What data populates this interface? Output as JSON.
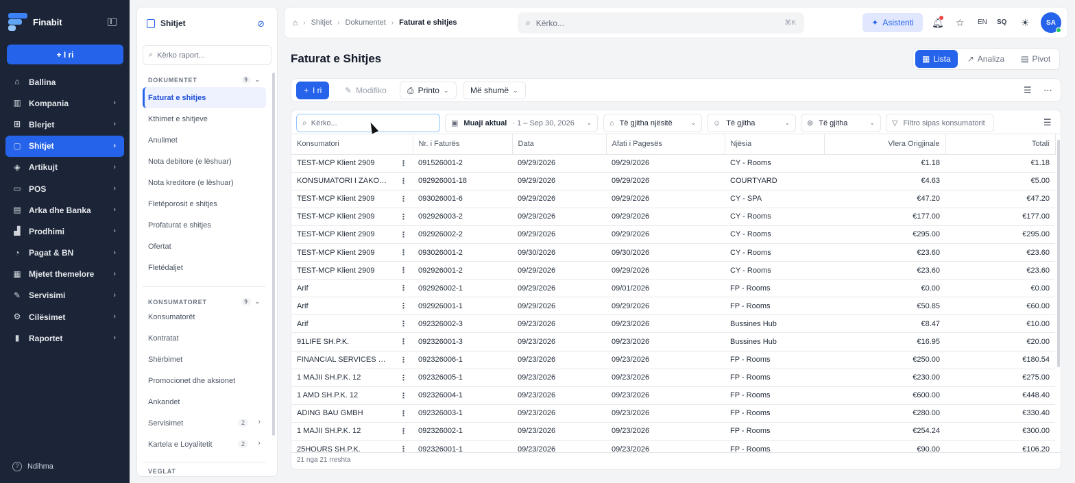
{
  "app": {
    "name": "Finabit",
    "new_label": "+ I ri",
    "help_label": "Ndihma"
  },
  "nav": {
    "items": [
      {
        "label": "Ballina",
        "icon": "home-icon"
      },
      {
        "label": "Kompania",
        "icon": "building-icon"
      },
      {
        "label": "Blerjet",
        "icon": "cart-icon"
      },
      {
        "label": "Shitjet",
        "icon": "bag-icon",
        "active": true
      },
      {
        "label": "Artikujt",
        "icon": "box-icon"
      },
      {
        "label": "POS",
        "icon": "monitor-icon"
      },
      {
        "label": "Arka dhe Banka",
        "icon": "wallet-icon"
      },
      {
        "label": "Prodhimi",
        "icon": "factory-icon"
      },
      {
        "label": "Pagat & BN",
        "icon": "money-icon"
      },
      {
        "label": "Mjetet themelore",
        "icon": "archive-icon"
      },
      {
        "label": "Servisimi",
        "icon": "wrench-icon"
      },
      {
        "label": "Cilësimet",
        "icon": "gear-icon"
      },
      {
        "label": "Raportet",
        "icon": "chart-icon"
      }
    ]
  },
  "panel": {
    "title": "Shitjet",
    "search_placeholder": "Kërko raport...",
    "sections": [
      {
        "title": "DOKUMENTET",
        "count": "9",
        "items": [
          "Faturat e shitjes",
          "Kthimet e shitjeve",
          "Anulimet",
          "Nota debitore (e lëshuar)",
          "Nota kreditore (e lëshuar)",
          "Fletëporosit e shitjes",
          "Profaturat e shitjes",
          "Ofertat",
          "Fletëdaljet"
        ]
      },
      {
        "title": "KONSUMATORET",
        "count": "9",
        "items": [
          "Konsumatorët",
          "Kontratat",
          "Shërbimet",
          "Promocionet dhe aksionet",
          "Ankandet",
          "Servisimet",
          "Kartela e Loyalitetit"
        ],
        "badges": {
          "Servisimet": "2",
          "Kartela e Loyalitetit": "2"
        }
      },
      {
        "title": "VEGLAT"
      }
    ]
  },
  "topbar": {
    "breadcrumb": [
      "Shitjet",
      "Dokumentet",
      "Faturat e shitjes"
    ],
    "search_placeholder": "Kërko...",
    "search_kbd": "⌘K",
    "assistant_label": "Asistenti",
    "lang_en": "EN",
    "lang_sq": "SQ",
    "avatar": "SA"
  },
  "page": {
    "title": "Faturat e Shitjes",
    "views": [
      "Lista",
      "Analiza",
      "Pivot"
    ],
    "toolbar": {
      "new": "I ri",
      "edit": "Modifiko",
      "print": "Printo",
      "more": "Më shumë"
    },
    "filters": {
      "search_placeholder": "Kërko...",
      "period_label": "Muaji aktual",
      "period_range": "· 1 – Sep 30, 2026",
      "unit": "Të gjitha njësitë",
      "group": "Të gjitha",
      "region": "Të gjitha",
      "customer_placeholder": "Filtro sipas konsumatorit"
    }
  },
  "table": {
    "columns": [
      "Konsumatori",
      "Nr. i Faturës",
      "Data",
      "Afati i Pagesës",
      "Njësia",
      "Vlera Origjinale",
      "Totali"
    ],
    "rows": [
      [
        "TEST-MCP Klient 2909",
        "091526001-2",
        "09/29/2026",
        "09/29/2026",
        "CY - Rooms",
        "€1.18",
        "€1.18"
      ],
      [
        "KONSUMATORI I ZAKONSH...",
        "092926001-18",
        "09/29/2026",
        "09/29/2026",
        "COURTYARD",
        "€4.63",
        "€5.00"
      ],
      [
        "TEST-MCP Klient 2909",
        "093026001-6",
        "09/29/2026",
        "09/29/2026",
        "CY - SPA",
        "€47.20",
        "€47.20"
      ],
      [
        "TEST-MCP Klient 2909",
        "092926003-2",
        "09/29/2026",
        "09/29/2026",
        "CY - Rooms",
        "€177.00",
        "€177.00"
      ],
      [
        "TEST-MCP Klient 2909",
        "092926002-2",
        "09/29/2026",
        "09/29/2026",
        "CY - Rooms",
        "€295.00",
        "€295.00"
      ],
      [
        "TEST-MCP Klient 2909",
        "093026001-2",
        "09/30/2026",
        "09/30/2026",
        "CY - Rooms",
        "€23.60",
        "€23.60"
      ],
      [
        "TEST-MCP Klient 2909",
        "092926001-2",
        "09/29/2026",
        "09/29/2026",
        "CY - Rooms",
        "€23.60",
        "€23.60"
      ],
      [
        "Arif",
        "092926002-1",
        "09/29/2026",
        "09/01/2026",
        "FP - Rooms",
        "€0.00",
        "€0.00"
      ],
      [
        "Arif",
        "092926001-1",
        "09/29/2026",
        "09/29/2026",
        "FP - Rooms",
        "€50.85",
        "€60.00"
      ],
      [
        "Arif",
        "092326002-3",
        "09/23/2026",
        "09/23/2026",
        "Bussines Hub",
        "€8.47",
        "€10.00"
      ],
      [
        "91LIFE SH.P.K.",
        "092326001-3",
        "09/23/2026",
        "09/23/2026",
        "Bussines Hub",
        "€16.95",
        "€20.00"
      ],
      [
        "FINANCIAL SERVICES VOL...",
        "092326006-1",
        "09/23/2026",
        "09/23/2026",
        "FP - Rooms",
        "€250.00",
        "€180.54"
      ],
      [
        "1 MAJII SH.P.K. 12",
        "092326005-1",
        "09/23/2026",
        "09/23/2026",
        "FP - Rooms",
        "€230.00",
        "€275.00"
      ],
      [
        "1 AMD SH.P.K. 12",
        "092326004-1",
        "09/23/2026",
        "09/23/2026",
        "FP - Rooms",
        "€600.00",
        "€448.40"
      ],
      [
        "ADING BAU GMBH",
        "092326003-1",
        "09/23/2026",
        "09/23/2026",
        "FP - Rooms",
        "€280.00",
        "€330.40"
      ],
      [
        "1 MAJII SH.P.K. 12",
        "092326002-1",
        "09/23/2026",
        "09/23/2026",
        "FP - Rooms",
        "€254.24",
        "€300.00"
      ],
      [
        "25HOURS SH.P.K.",
        "092326001-1",
        "09/23/2026",
        "09/23/2026",
        "FP - Rooms",
        "€90.00",
        "€106.20"
      ]
    ],
    "footer": "21 nga 21 rreshta"
  },
  "colors": {
    "sidebar": "#1b2537",
    "accent": "#2563eb"
  }
}
